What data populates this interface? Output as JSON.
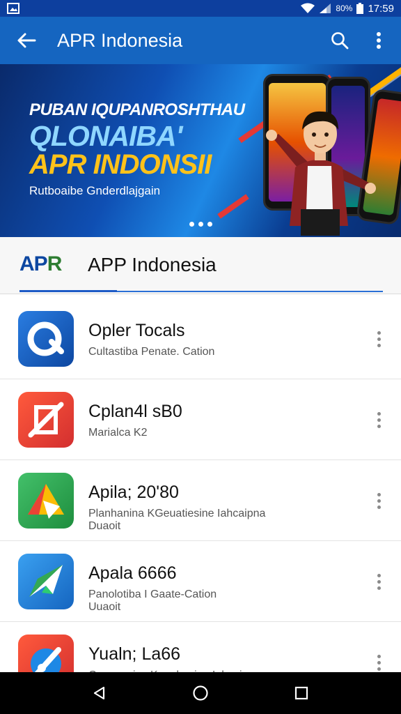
{
  "status_bar": {
    "battery_text": "80%",
    "time": "17:59"
  },
  "app_bar": {
    "title": "APR Indonesia"
  },
  "banner": {
    "line1": "PUBAN IQUPANROSHTHAU",
    "line2": "QLONAIBA'",
    "line3": "APR INDONSII",
    "line4": "Rutboaibe Gnderdlajgain"
  },
  "section": {
    "logo_text_a": "AP",
    "logo_text_b": "R",
    "title": "APP Indonesia"
  },
  "apps": [
    {
      "title": "Opler Tocals",
      "subtitle": "Cultastiba Penate. Cation",
      "subtitle2": "",
      "icon": "circle-q-icon",
      "color": "#1a5fc8"
    },
    {
      "title": "Cplan4l sB0",
      "subtitle": "Marialca K2",
      "subtitle2": "",
      "icon": "slash-x-icon",
      "color": "#e53935"
    },
    {
      "title": "Apila; 20'80",
      "subtitle": "Planhanina KGeuatiesine Iahcaipna",
      "subtitle2": "Duaoit",
      "icon": "triangle-arrow-icon",
      "color": "#34a853"
    },
    {
      "title": "Apala 6666",
      "subtitle": "Panolotiba I Gaate-Cation",
      "subtitle2": "Uuaoit",
      "icon": "rocket-icon",
      "color": "#1e88e5"
    },
    {
      "title": "Yualn; La66",
      "subtitle": "Capanasica Kauahasine Iahcaipna",
      "subtitle2": "",
      "icon": "pen-tool-icon",
      "color": "#e53935"
    }
  ]
}
